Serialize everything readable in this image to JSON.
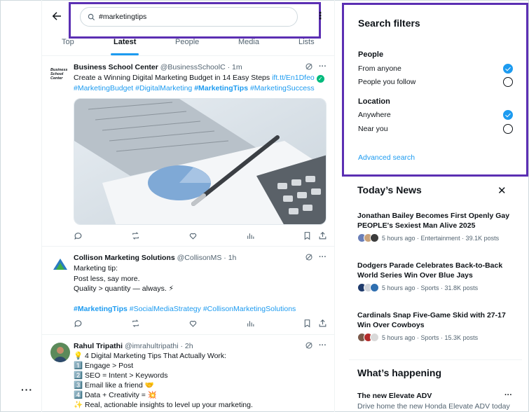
{
  "search": {
    "value": "#marketingtips"
  },
  "tabs": [
    "Top",
    "Latest",
    "People",
    "Media",
    "Lists"
  ],
  "tweets": [
    {
      "name": "Business School Center",
      "handle": "@BusinessSchoolC",
      "time": "· 1m",
      "avatar_text": "Business School Center",
      "text": "Create a Winning Digital Marketing Budget in 14 Easy Steps",
      "link": "ift.tt/En1Dfeo",
      "tags": [
        "#MarketingBudget",
        "#DigitalMarketing",
        "#MarketingTips",
        "#MarketingSuccess"
      ]
    },
    {
      "name": "Collison Marketing Solutions",
      "handle": "@CollisonMS",
      "time": "· 1h",
      "lines": [
        "Marketing tip:",
        "Post less, say more.",
        "Quality > quantity — always. ⚡"
      ],
      "tags": [
        "#MarketingTips",
        "#SocialMediaStrategy",
        "#CollisonMarketingSolutions"
      ]
    },
    {
      "name": "Rahul Tripathi",
      "handle": "@imrahultripathi",
      "time": "· 2h",
      "lines": [
        "💡 4 Digital Marketing Tips That Actually Work:",
        "1️⃣ Engage > Post",
        "2️⃣ SEO = Intent > Keywords",
        "3️⃣ Email like a friend 🤝",
        "4️⃣ Data + Creativity = 💥",
        "✨ Real, actionable insights to level up your marketing."
      ]
    }
  ],
  "filters": {
    "title": "Search filters",
    "people_label": "People",
    "people_options": [
      "From anyone",
      "People you follow"
    ],
    "location_label": "Location",
    "location_options": [
      "Anywhere",
      "Near you"
    ],
    "advanced": "Advanced search"
  },
  "news": {
    "title": "Today’s News",
    "items": [
      {
        "headline": "Jonathan Bailey Becomes First Openly Gay PEOPLE's Sexiest Man Alive 2025",
        "meta": "5 hours ago · Entertainment · 39.1K posts"
      },
      {
        "headline": "Dodgers Parade Celebrates Back-to-Back World Series Win Over Blue Jays",
        "meta": "5 hours ago · Sports · 31.8K posts"
      },
      {
        "headline": "Cardinals Snap Five-Game Skid with 27-17 Win Over Cowboys",
        "meta": "5 hours ago · Sports · 15.3K posts"
      }
    ]
  },
  "happening": {
    "title": "What’s happening",
    "item_title": "The new Elevate ADV",
    "item_sub": "Drive home the new Honda Elevate ADV today"
  },
  "colors": {
    "accent": "#1d9bf0",
    "highlight": "#5b2fb3"
  }
}
